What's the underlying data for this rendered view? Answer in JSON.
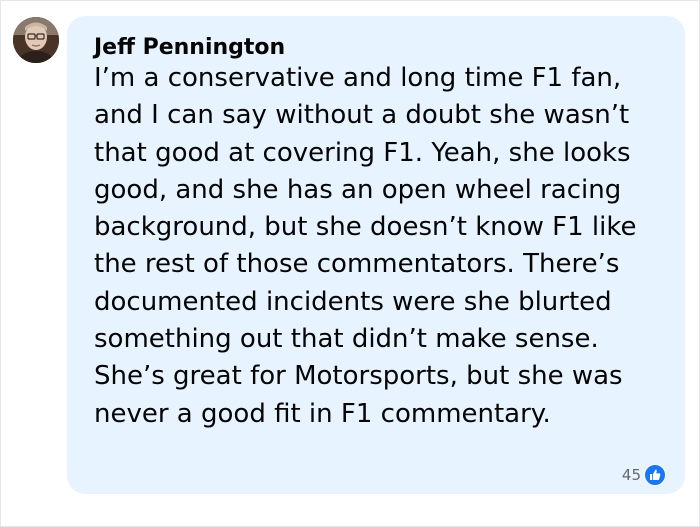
{
  "comment": {
    "author": "Jeff Pennington",
    "text": "I’m a conservative and long time F1 fan, and I can say without a doubt she wasn’t that good at covering F1. Yeah, she looks good, and she has an open wheel racing background, but she doesn’t know F1 like the rest of those commentators. There’s documented incidents were she blurted something out that didn’t make sense. She’s great for Motorsports, but she was never a good fit in F1 commentary.",
    "reaction_count": "45",
    "reaction_icon": "like-icon"
  },
  "colors": {
    "bubble_background": "#e7f3ff",
    "like_blue": "#1877f2",
    "text": "#050505",
    "muted_text": "#65676b"
  }
}
